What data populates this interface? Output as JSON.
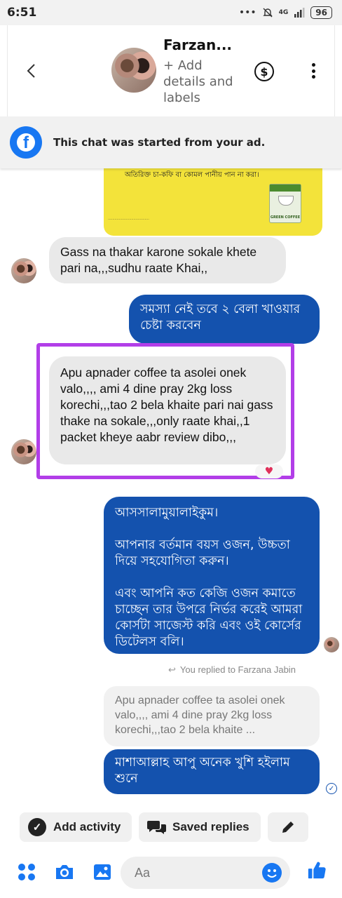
{
  "status_bar": {
    "time": "6:51",
    "network": "4G",
    "battery": "96"
  },
  "header": {
    "contact_name": "Farzan...",
    "contact_sub": "+ Add details and labels",
    "icons": [
      "back-arrow-icon",
      "dollar-icon",
      "more-vertical-icon"
    ]
  },
  "ad_notice": {
    "text": "This chat was started from your ad.",
    "icon": "facebook-icon"
  },
  "ad_image": {
    "line": "অতিরিক্ত চা-কফি বা কোমল পানীয় পান না করা।",
    "product_label": "GREEN COFFEE"
  },
  "messages": [
    {
      "direction": "incoming",
      "text": "Gass na thakar karone sokale khete pari na,,,sudhu raate Khai,,"
    },
    {
      "direction": "outgoing",
      "text": "সমস্যা নেই তবে ২ বেলা খাওয়ার চেষ্টা করবেন"
    },
    {
      "direction": "incoming",
      "text": "Apu apnader coffee ta asolei onek valo,,,, ami 4 dine pray 2kg loss korechi,,,tao 2 bela khaite pari nai gass thake na sokale,,,only raate khai,,1 packet  kheye aabr review dibo,,,"
    },
    {
      "direction": "outgoing",
      "paragraphs": [
        "আসসালামুয়ালাইকুম।",
        "আপনার বর্তমান বয়স ওজন, উচ্চতা দিয়ে সহযোগিতা করুন।",
        "এবং আপনি কত কেজি ওজন কমাতে চাচ্ছেন তার উপরে নির্ভর করেই আমরা কোর্সটা সাজেস্ট করি এবং ওই কোর্সের ডিটেলস বলি।"
      ]
    },
    {
      "direction": "outgoing",
      "text": "মাশাআল্লাহ আপু অনেক খুশি হইলাম শুনে"
    }
  ],
  "reply_context": {
    "label": "You replied to Farzana Jabin",
    "quoted": "Apu apnader coffee ta asolei onek valo,,,, ami 4 dine pray 2kg loss korechi,,,tao 2 bela khaite ..."
  },
  "chips": {
    "add_activity": "Add activity",
    "saved_replies": "Saved replies"
  },
  "composer": {
    "placeholder": "Aa"
  },
  "colors": {
    "outgoing": "#1452ae",
    "incoming": "#e9e9e9",
    "highlight": "#b23ee8",
    "accent": "#1877f2"
  }
}
